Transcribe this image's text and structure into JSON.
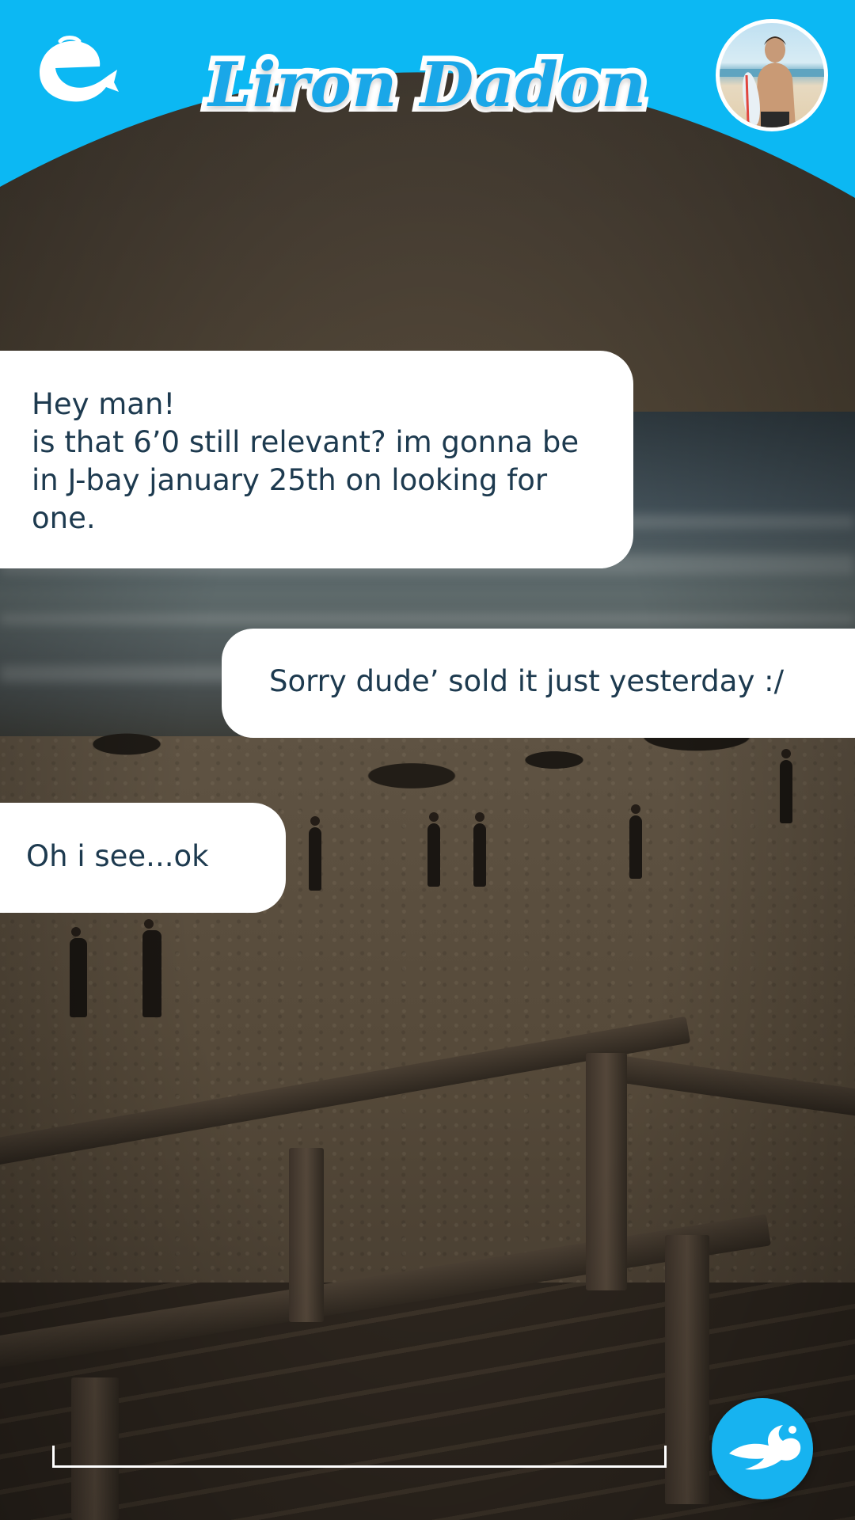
{
  "header": {
    "contact_name": "Liron Dadon",
    "logo_icon": "whale-e-logo-icon",
    "avatar_icon": "contact-avatar",
    "accent_color": "#0db7f2"
  },
  "messages": [
    {
      "direction": "incoming",
      "text": "Hey man!\nis that 6’0 still relevant? im gonna be in J-bay january 25th on looking for one."
    },
    {
      "direction": "outgoing",
      "text": "Sorry dude’ sold it just yesterday :/"
    },
    {
      "direction": "incoming",
      "text": "Oh i see...ok"
    }
  ],
  "composer": {
    "input_value": "",
    "send_icon": "splash-send-icon"
  }
}
